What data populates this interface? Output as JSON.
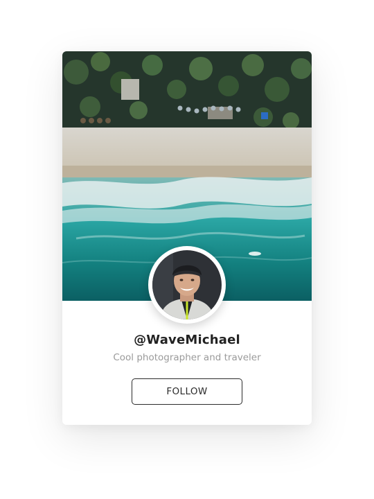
{
  "profile": {
    "username": "@WaveMichael",
    "tagline": "Cool photographer and traveler",
    "follow_label": "FOLLOW",
    "cover_image": "aerial-beach-photo",
    "avatar_image": "profile-photo"
  },
  "colors": {
    "card_bg": "#ffffff",
    "button_border": "#2a2a2a",
    "tagline": "#9a9a9a",
    "username": "#222222"
  }
}
